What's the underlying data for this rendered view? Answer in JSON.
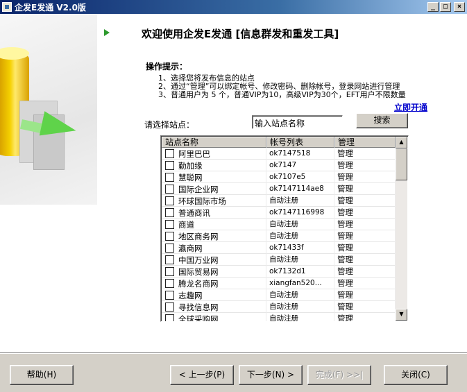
{
  "window": {
    "title": "企发E发通 V2.0版",
    "min_glyph": "_",
    "max_glyph": "□",
    "close_glyph": "×"
  },
  "heading": "欢迎使用企发E发通 [信息群发和重发工具]",
  "tips": {
    "title": "操作提示：",
    "lines": [
      "1、选择您将发布信息的站点",
      "2、通过“管理”可以绑定帐号、修改密码、删除帐号，登录网站进行管理",
      "3、普通用户为 5 个，普通VIP为10，高级VIP为30个，EFT用户不限数量"
    ]
  },
  "open_link": "立即开通",
  "search": {
    "label": "请选择站点：",
    "value": "输入站点名称",
    "button": "搜索"
  },
  "table": {
    "columns": [
      "站点名称",
      "帐号列表",
      "管理"
    ],
    "rows": [
      {
        "site": "阿里巴巴",
        "account": "ok7147518",
        "manage": "管理"
      },
      {
        "site": "勤加缘",
        "account": "ok7147",
        "manage": "管理"
      },
      {
        "site": "慧聪网",
        "account": "ok7107e5",
        "manage": "管理"
      },
      {
        "site": "国际企业网",
        "account": "ok7147114ae8",
        "manage": "管理"
      },
      {
        "site": "环球国际市场",
        "account": "自动注册",
        "manage": "管理"
      },
      {
        "site": "普通商讯",
        "account": "ok7147116998",
        "manage": "管理"
      },
      {
        "site": "商道",
        "account": "自动注册",
        "manage": "管理"
      },
      {
        "site": "地区商务网",
        "account": "自动注册",
        "manage": "管理"
      },
      {
        "site": "瀛商网",
        "account": "ok71433f",
        "manage": "管理"
      },
      {
        "site": "中国万业网",
        "account": "自动注册",
        "manage": "管理"
      },
      {
        "site": "国际贸易网",
        "account": "ok7132d1",
        "manage": "管理"
      },
      {
        "site": "腾龙名商网",
        "account": "xiangfan520...",
        "manage": "管理"
      },
      {
        "site": "志趣网",
        "account": "自动注册",
        "manage": "管理"
      },
      {
        "site": "寻找信息网",
        "account": "自动注册",
        "manage": "管理"
      },
      {
        "site": "全球采购网",
        "account": "自动注册",
        "manage": "管理"
      }
    ]
  },
  "footer": {
    "help": "帮助(H)",
    "prev": "< 上一步(P)",
    "next": "下一步(N) >",
    "finish": "完成(F) >>|",
    "close": "关闭(C)"
  }
}
